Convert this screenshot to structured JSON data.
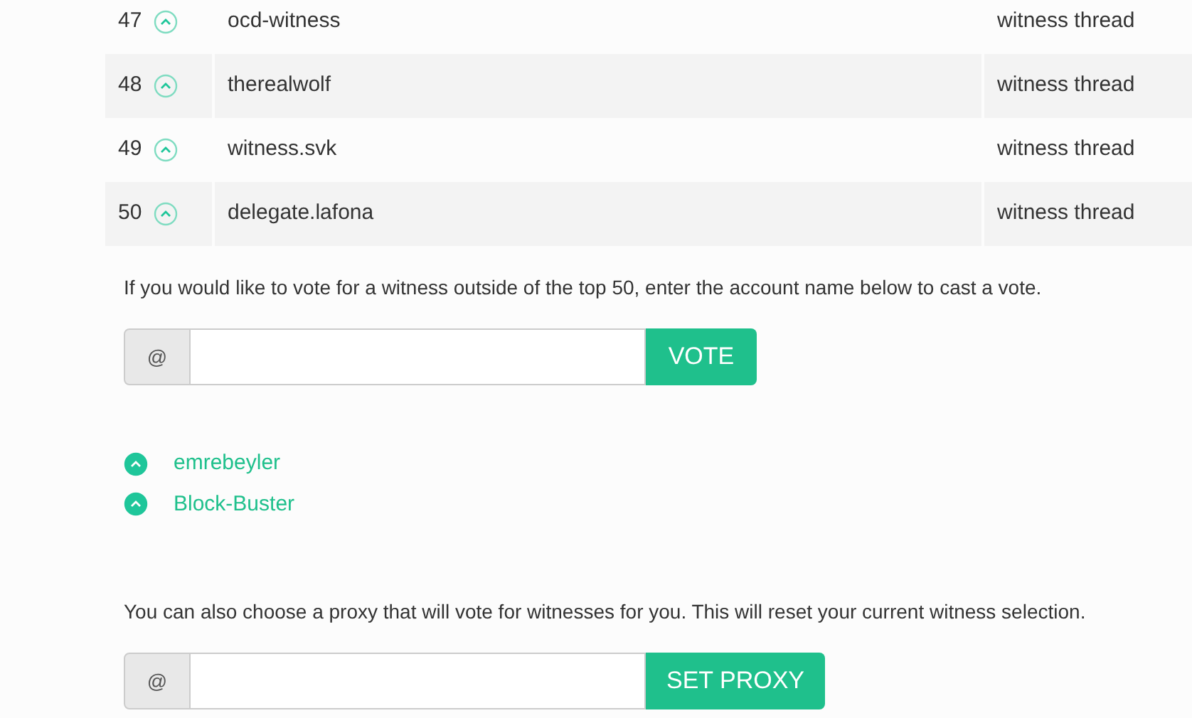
{
  "witnesses": [
    {
      "rank": "47",
      "name": "ocd-witness",
      "link": "witness thread",
      "voted": false
    },
    {
      "rank": "48",
      "name": "therealwolf",
      "link": "witness thread",
      "voted": false
    },
    {
      "rank": "49",
      "name": "witness.svk",
      "link": "witness thread",
      "voted": false
    },
    {
      "rank": "50",
      "name": "delegate.lafona",
      "link": "witness thread",
      "voted": false
    }
  ],
  "vote_note": "If you would like to vote for a witness outside of the top 50, enter the account name below to cast a vote.",
  "vote_form": {
    "prefix": "@",
    "button": "VOTE"
  },
  "my_votes": [
    {
      "name": "emrebeyler",
      "voted": true
    },
    {
      "name": "Block-Buster",
      "voted": true
    }
  ],
  "proxy_note": "You can also choose a proxy that will vote for witnesses for you. This will reset your current witness selection.",
  "proxy_form": {
    "prefix": "@",
    "button": "SET PROXY"
  }
}
